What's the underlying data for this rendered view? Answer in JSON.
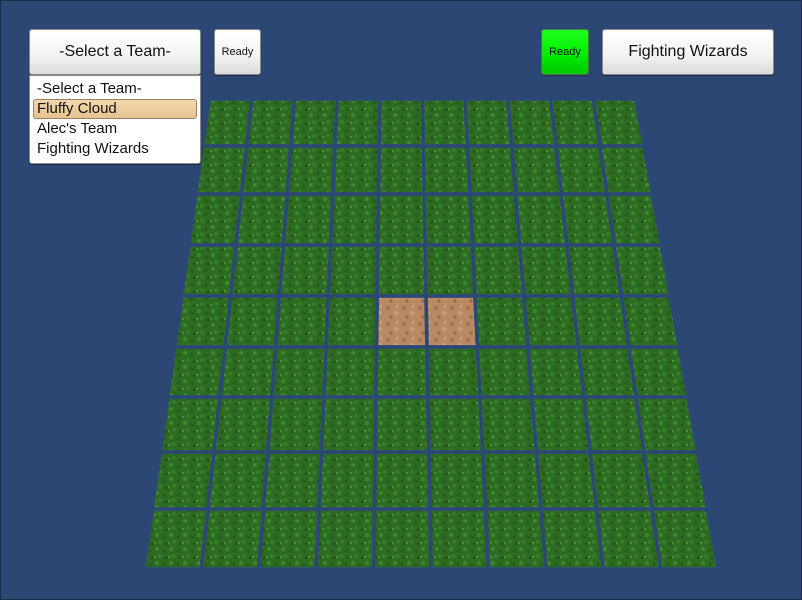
{
  "left_panel": {
    "team_select_label": "-Select a Team-",
    "ready_label": "Ready",
    "dropdown_options": [
      {
        "label": "-Select a Team-",
        "selected": false
      },
      {
        "label": "Fluffy Cloud",
        "selected": true
      },
      {
        "label": "Alec's Team",
        "selected": false
      },
      {
        "label": "Fighting Wizards",
        "selected": false
      }
    ]
  },
  "right_panel": {
    "ready_label": "Ready",
    "ready_state": true,
    "team_label": "Fighting Wizards"
  },
  "board": {
    "columns": 10,
    "rows": 9,
    "tile_types": {
      "grass": "#2f6e22",
      "dirt": "#b98a63"
    },
    "dirt_tiles": [
      [
        4,
        4
      ],
      [
        4,
        5
      ]
    ],
    "grid_line_color": "#2f4d78"
  },
  "colors": {
    "background": "#2d4775",
    "ready_active": "#00ee00",
    "selection_highlight": "#e6c390"
  }
}
